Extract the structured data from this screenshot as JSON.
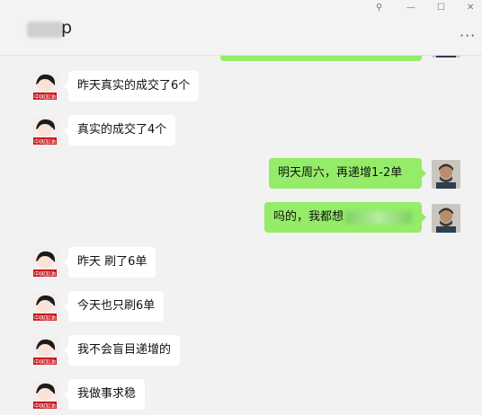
{
  "window": {
    "title_suffix": "p",
    "controls": {
      "pin": "⚲",
      "minimize": "—",
      "maximize": "☐",
      "close": "✕"
    },
    "more": "···"
  },
  "messages": [
    {
      "side": "in",
      "text": "昨天真实的成交了6个",
      "avatar": "cartoon-avatar"
    },
    {
      "side": "in",
      "text": "真实的成交了4个",
      "avatar": "cartoon-avatar"
    },
    {
      "side": "out",
      "text": "明天周六，再递增1-2单",
      "avatar": "photo-avatar"
    },
    {
      "side": "out",
      "text": "吗的，我都想",
      "redacted": true,
      "avatar": "photo-avatar"
    },
    {
      "side": "in",
      "text": "昨天 刷了6单",
      "avatar": "cartoon-avatar"
    },
    {
      "side": "in",
      "text": "今天也只刷6单",
      "avatar": "cartoon-avatar"
    },
    {
      "side": "in",
      "text": "我不会盲目递增的",
      "avatar": "cartoon-avatar"
    },
    {
      "side": "in",
      "text": "我做事求稳",
      "avatar": "cartoon-avatar"
    }
  ],
  "avatar_badge_text": "中国加油",
  "colors": {
    "out_bubble": "#95ec69",
    "in_bubble": "#ffffff",
    "background": "#f2f2f2"
  }
}
